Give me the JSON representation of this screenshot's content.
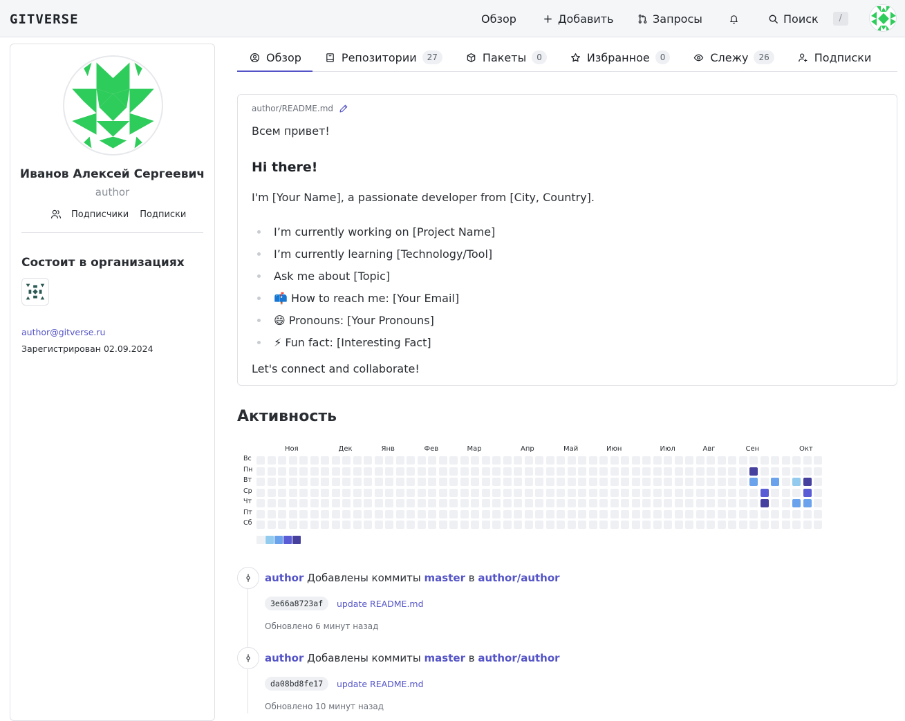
{
  "header": {
    "logo": "GITVERSE",
    "nav": {
      "overview": "Обзор",
      "add": "Добавить",
      "requests": "Запросы",
      "search": "Поиск",
      "search_shortcut": "/"
    }
  },
  "profile": {
    "full_name": "Иванов Алексей Сергеевич",
    "login": "author",
    "followers_label": "Подписчики",
    "following_label": "Подписки",
    "orgs_title": "Состоит в организациях",
    "email": "author@gitverse.ru",
    "registered": "Зарегистрирован 02.09.2024"
  },
  "tabs": [
    {
      "label": "Обзор",
      "count": null,
      "icon": "user-circle-icon",
      "active": true
    },
    {
      "label": "Репозитории",
      "count": "27",
      "icon": "book-icon",
      "active": false
    },
    {
      "label": "Пакеты",
      "count": "0",
      "icon": "package-icon",
      "active": false
    },
    {
      "label": "Избранное",
      "count": "0",
      "icon": "star-icon",
      "active": false
    },
    {
      "label": "Слежу",
      "count": "26",
      "icon": "eye-icon",
      "active": false
    },
    {
      "label": "Подписки",
      "count": null,
      "icon": "user-plus-icon",
      "active": false
    }
  ],
  "readme": {
    "path": "author/README.md",
    "greeting": "Всем привет!",
    "heading": "Hi there!",
    "intro": "I'm [Your Name], a passionate developer from [City, Country].",
    "items": [
      "I’m currently working on [Project Name]",
      "I’m currently learning [Technology/Tool]",
      "Ask me about [Topic]",
      "📫 How to reach me: [Your Email]",
      "😄 Pronouns: [Your Pronouns]",
      "⚡ Fun fact: [Interesting Fact]"
    ],
    "outro": "Let's connect and collaborate!"
  },
  "activity": {
    "title": "Активность",
    "months": [
      "Ноя",
      "Дек",
      "Янв",
      "Фев",
      "Мар",
      "Апр",
      "Май",
      "Июн",
      "Июл",
      "Авг",
      "Сен",
      "Окт"
    ],
    "month_start_weeks": [
      2,
      7,
      11,
      15,
      19,
      24,
      28,
      32,
      37,
      41,
      45,
      50
    ],
    "days": [
      "Вс",
      "Пн",
      "Вт",
      "Ср",
      "Чт",
      "Пт",
      "Сб"
    ],
    "weeks": 53,
    "levels_legend": [
      0,
      1,
      2,
      3,
      4
    ],
    "level_colors": [
      "#eef0f4",
      "#93cbef",
      "#6aa3ec",
      "#5a5cd6",
      "#46409e"
    ],
    "active_cells": [
      {
        "week": 46,
        "day": 1,
        "level": 4
      },
      {
        "week": 46,
        "day": 2,
        "level": 2
      },
      {
        "week": 47,
        "day": 3,
        "level": 3
      },
      {
        "week": 47,
        "day": 4,
        "level": 4
      },
      {
        "week": 48,
        "day": 2,
        "level": 2
      },
      {
        "week": 50,
        "day": 2,
        "level": 1
      },
      {
        "week": 50,
        "day": 4,
        "level": 2
      },
      {
        "week": 51,
        "day": 2,
        "level": 4
      },
      {
        "week": 51,
        "day": 3,
        "level": 3
      },
      {
        "week": 51,
        "day": 4,
        "level": 2
      }
    ]
  },
  "feed": [
    {
      "user": "author",
      "action": "Добавлены коммиты",
      "branch": "master",
      "preposition": "в",
      "repo": "author/author",
      "sha": "3e66a8723af",
      "message": "update README.md",
      "updated": "Обновлено 6 минут назад"
    },
    {
      "user": "author",
      "action": "Добавлены коммиты",
      "branch": "master",
      "preposition": "в",
      "repo": "author/author",
      "sha": "da08bd8fe17",
      "message": "update README.md",
      "updated": "Обновлено 10 минут назад"
    }
  ],
  "colors": {
    "accent": "#5454c8",
    "identicon_green": "#2ecc5a",
    "org_identicon": "#2b5a55"
  }
}
